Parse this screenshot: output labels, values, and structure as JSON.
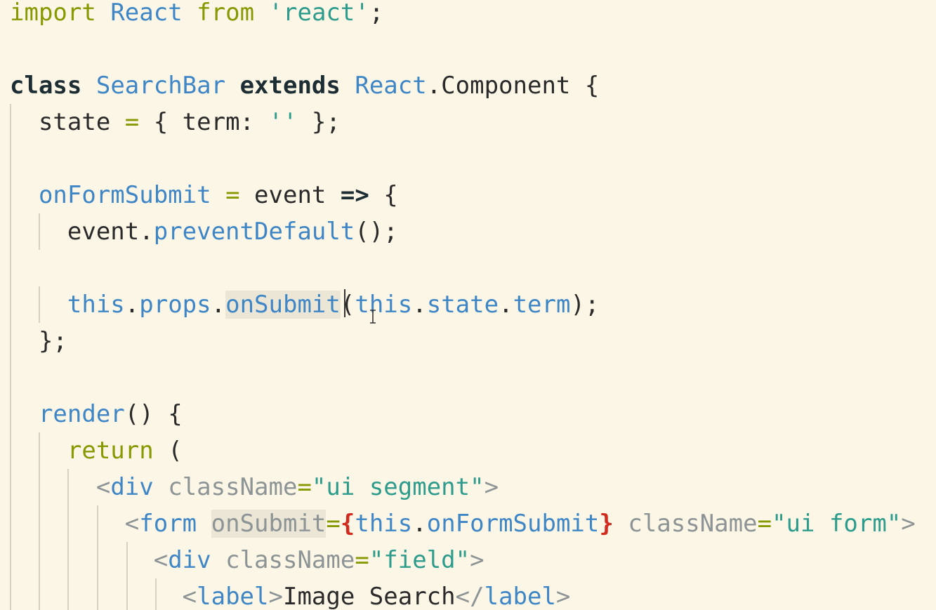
{
  "theme_colors": {
    "background": "#fcf6e6",
    "default": "#2a2a2a",
    "keyword_olive": "#859900",
    "identifier_blue": "#3f86c6",
    "string_teal": "#2e9c8c",
    "bold_dark": "#1c2d33",
    "attribute_gray": "#8d9496",
    "brace_red": "#d12a1f",
    "tag_gray": "#8d9496"
  },
  "code_lines": [
    {
      "tokens": [
        {
          "text": "import",
          "style": "keyword_olive"
        },
        {
          "text": " "
        },
        {
          "text": "React",
          "style": "identifier_blue"
        },
        {
          "text": " "
        },
        {
          "text": "from",
          "style": "keyword_olive"
        },
        {
          "text": " "
        },
        {
          "text": "'react'",
          "style": "string_teal"
        },
        {
          "text": ";"
        }
      ]
    },
    {
      "tokens": []
    },
    {
      "tokens": [
        {
          "text": "class",
          "style": "bold_dark"
        },
        {
          "text": " "
        },
        {
          "text": "SearchBar",
          "style": "identifier_blue"
        },
        {
          "text": " "
        },
        {
          "text": "extends",
          "style": "bold_dark"
        },
        {
          "text": " "
        },
        {
          "text": "React",
          "style": "identifier_blue"
        },
        {
          "text": ".Component {"
        }
      ]
    },
    {
      "tokens": [
        {
          "text": "  state "
        },
        {
          "text": "=",
          "style": "keyword_olive"
        },
        {
          "text": " { term: "
        },
        {
          "text": "''",
          "style": "string_teal"
        },
        {
          "text": " };"
        }
      ]
    },
    {
      "tokens": []
    },
    {
      "tokens": [
        {
          "text": "  "
        },
        {
          "text": "onFormSubmit",
          "style": "identifier_blue"
        },
        {
          "text": " "
        },
        {
          "text": "=",
          "style": "keyword_olive"
        },
        {
          "text": " event "
        },
        {
          "text": "=>",
          "style": "bold_dark"
        },
        {
          "text": " {"
        }
      ]
    },
    {
      "tokens": [
        {
          "text": "    event."
        },
        {
          "text": "preventDefault",
          "style": "identifier_blue"
        },
        {
          "text": "();"
        }
      ]
    },
    {
      "tokens": []
    },
    {
      "tokens": [
        {
          "text": "    "
        },
        {
          "text": "this",
          "style": "identifier_blue"
        },
        {
          "text": "."
        },
        {
          "text": "props",
          "style": "identifier_blue"
        },
        {
          "text": "."
        },
        {
          "text": "onSubmit",
          "style": "identifier_blue",
          "highlight": true
        },
        {
          "text": "("
        },
        {
          "text": "this",
          "style": "identifier_blue"
        },
        {
          "text": "."
        },
        {
          "text": "state",
          "style": "identifier_blue"
        },
        {
          "text": "."
        },
        {
          "text": "term",
          "style": "identifier_blue"
        },
        {
          "text": ");"
        }
      ]
    },
    {
      "tokens": [
        {
          "text": "  };"
        }
      ]
    },
    {
      "tokens": []
    },
    {
      "tokens": [
        {
          "text": "  "
        },
        {
          "text": "render",
          "style": "identifier_blue"
        },
        {
          "text": "() {"
        }
      ]
    },
    {
      "tokens": [
        {
          "text": "    "
        },
        {
          "text": "return",
          "style": "keyword_olive"
        },
        {
          "text": " ("
        }
      ]
    },
    {
      "tokens": [
        {
          "text": "      "
        },
        {
          "text": "<",
          "style": "tag_gray"
        },
        {
          "text": "div",
          "style": "identifier_blue"
        },
        {
          "text": " "
        },
        {
          "text": "className",
          "style": "attribute_gray"
        },
        {
          "text": "=",
          "style": "keyword_olive"
        },
        {
          "text": "\"ui segment\"",
          "style": "string_teal"
        },
        {
          "text": ">",
          "style": "tag_gray"
        }
      ]
    },
    {
      "tokens": [
        {
          "text": "        "
        },
        {
          "text": "<",
          "style": "tag_gray"
        },
        {
          "text": "form",
          "style": "identifier_blue"
        },
        {
          "text": " "
        },
        {
          "text": "onSubmit",
          "style": "attribute_gray",
          "highlight": true
        },
        {
          "text": "=",
          "style": "keyword_olive"
        },
        {
          "text": "{",
          "style": "brace_red"
        },
        {
          "text": "this",
          "style": "identifier_blue"
        },
        {
          "text": "."
        },
        {
          "text": "onFormSubmit",
          "style": "identifier_blue"
        },
        {
          "text": "}",
          "style": "brace_red"
        },
        {
          "text": " "
        },
        {
          "text": "className",
          "style": "attribute_gray"
        },
        {
          "text": "=",
          "style": "keyword_olive"
        },
        {
          "text": "\"ui form\"",
          "style": "string_teal"
        },
        {
          "text": ">",
          "style": "tag_gray"
        }
      ]
    },
    {
      "tokens": [
        {
          "text": "          "
        },
        {
          "text": "<",
          "style": "tag_gray"
        },
        {
          "text": "div",
          "style": "identifier_blue"
        },
        {
          "text": " "
        },
        {
          "text": "className",
          "style": "attribute_gray"
        },
        {
          "text": "=",
          "style": "keyword_olive"
        },
        {
          "text": "\"field\"",
          "style": "string_teal"
        },
        {
          "text": ">",
          "style": "tag_gray"
        }
      ]
    },
    {
      "tokens": [
        {
          "text": "            "
        },
        {
          "text": "<",
          "style": "tag_gray"
        },
        {
          "text": "label",
          "style": "identifier_blue"
        },
        {
          "text": ">",
          "style": "tag_gray"
        },
        {
          "text": "Image Search"
        },
        {
          "text": "</",
          "style": "tag_gray"
        },
        {
          "text": "label",
          "style": "identifier_blue"
        },
        {
          "text": ">",
          "style": "tag_gray"
        }
      ]
    }
  ]
}
